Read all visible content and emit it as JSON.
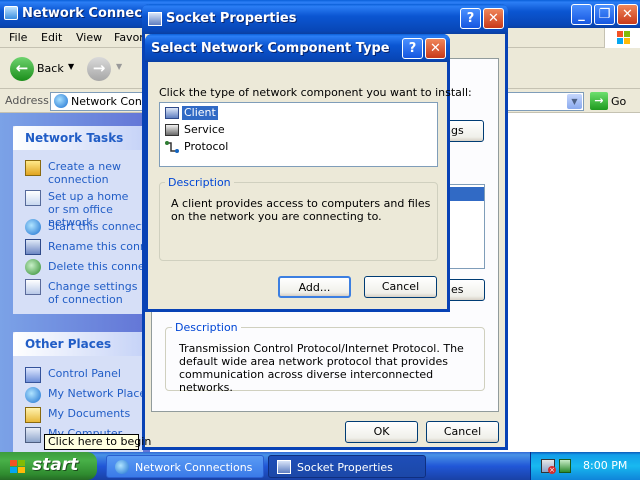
{
  "explorer": {
    "title": "Network Connections",
    "menu": [
      "File",
      "Edit",
      "View",
      "Favor"
    ],
    "back_label": "Back",
    "address_label": "Address",
    "address_value": "Network Conne",
    "go_label": "Go"
  },
  "network_tasks": {
    "header": "Network Tasks",
    "items": [
      "Create a new connection",
      "Set up a home or sm office network",
      "Start this connectio",
      "Rename this connec",
      "Delete this connecti",
      "Change settings of connection"
    ]
  },
  "other_places": {
    "header": "Other Places",
    "items": [
      "Control Panel",
      "My Network Places",
      "My Documents",
      "My Computer"
    ]
  },
  "socket_properties": {
    "title": "Socket Properties",
    "settings_fragment": "ings",
    "properties_fragment": "es",
    "description_label": "Description",
    "description_text": "Transmission Control Protocol/Internet Protocol. The default wide area network protocol that provides communication across diverse interconnected networks.",
    "ok_label": "OK",
    "cancel_label": "Cancel"
  },
  "select_dialog": {
    "title": "Select Network Component Type",
    "prompt": "Click the type of network component you want to install:",
    "components": [
      "Client",
      "Service",
      "Protocol"
    ],
    "selected": "Client",
    "description_label": "Description",
    "description_text": "A client provides access to computers and files on the network you are connecting to.",
    "add_label": "Add...",
    "cancel_label": "Cancel"
  },
  "tooltip": "Click here to begin",
  "taskbar": {
    "start_label": "start",
    "tasks": [
      "Network Connections",
      "Socket Properties"
    ],
    "clock": "8:00 PM"
  },
  "colors": {
    "title_blue": "#0846b6",
    "selection": "#316ac5",
    "link_blue": "#215dc6",
    "start_green": "#3c9c3c"
  }
}
